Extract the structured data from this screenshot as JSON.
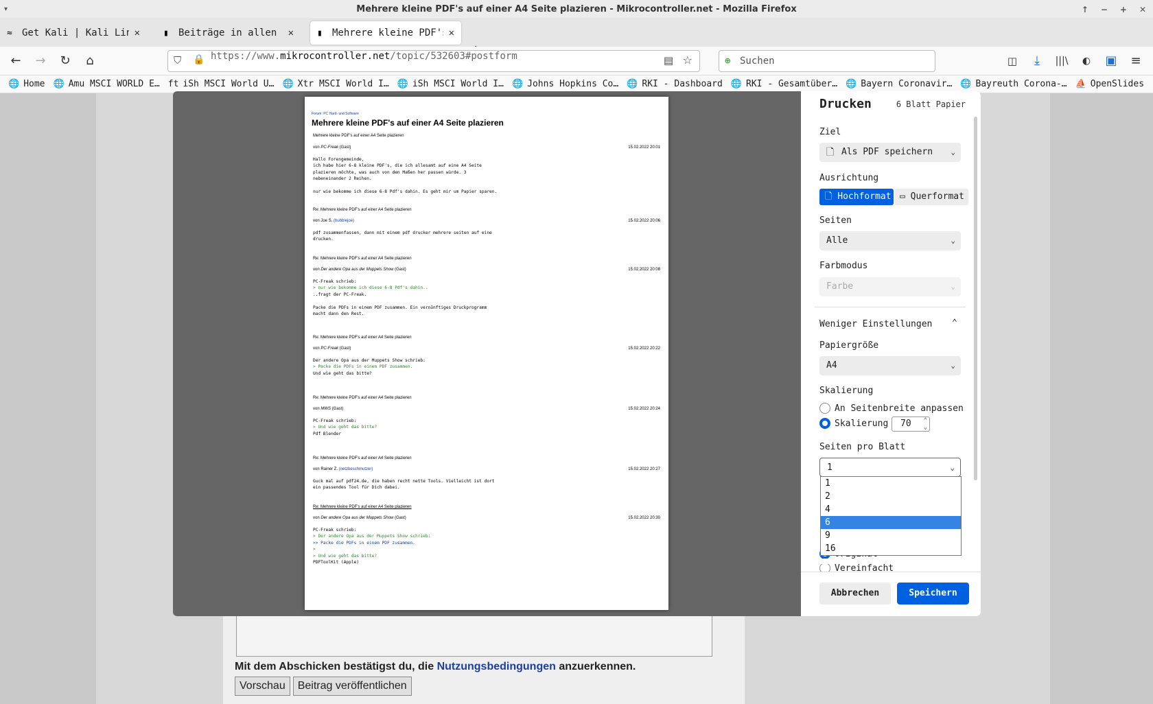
{
  "window": {
    "title": "Mehrere kleine PDF's auf einer A4 Seite plazieren - Mikrocontroller.net - Mozilla Firefox"
  },
  "tabs": [
    {
      "label": "Get Kali | Kali Linux"
    },
    {
      "label": "Beiträge in allen Foren"
    },
    {
      "label": "Mehrere kleine PDF's auf e"
    }
  ],
  "nav": {
    "url_prefix": "https://www.",
    "url_host": "mikrocontroller.net",
    "url_path": "/topic/532603#postform",
    "search_placeholder": "Suchen"
  },
  "bookmarks": [
    "Home",
    "Amu MSCI WORLD E…",
    "iSh MSCI World U…",
    "Xtr MSCI World I…",
    "iSh MSCI World I…",
    "Johns Hopkins Co…",
    "RKI - Dashboard",
    "RKI - Gesamtüber…",
    "Bayern Coronavir…",
    "Bayreuth Corona-…",
    "OpenSlides"
  ],
  "preview": {
    "forum": "Forum: PC Hard- und Software",
    "title": "Mehrere kleine PDF's auf einer A4 Seite plazieren",
    "subtitle": "Mehrere kleine PDF's auf einer A4 Seite plazieren",
    "posts": [
      {
        "header": "",
        "by": "von ",
        "author": "PC-Freak",
        "suffix": " (Gast)",
        "date": "15.02.2022 20:01",
        "body": "Hallo Forengemeinde,\nich habe hier 6-8 kleine PDF's, die ich allesamt auf eine A4 Seite\nplazieren möchte, was auch von den Maßen her passen würde. 3\nnebeneinander 2 Reihen.\n\nnur wie bekomme ich diese 6-8 Pdf's dahin. Es geht mir um Papier sparen."
      },
      {
        "header": "Re: Mehrere kleine PDF's auf einer A4 Seite plazieren",
        "by": "von ",
        "author": "Joe S.",
        "suffix": " (bubblejoe)",
        "date": "15.02.2022 20:06",
        "body": "pdf zusammenfassen, dann mit einem pdf drucker mehrere seiten auf eine\ndrucken."
      },
      {
        "header": "Re: Mehrere kleine PDF's auf einer A4 Seite plazieren",
        "by": "von ",
        "author": "Der andere Opa aus der Muppets Show",
        "suffix": " (Gast)",
        "date": "15.02.2022 20:08",
        "body_a": "PC-Freak schrieb:",
        "quote": "> nur wie bekomme ich diese 6-8 Pdf's dahin..",
        "body_b": "\n..fragt der PC-Freak.\n\nPacke die PDFs in einem PDF zusammen. Ein vernünftiges Druckprogramm\nmacht dann den Rest."
      },
      {
        "header": "Re: Mehrere kleine PDF's auf einer A4 Seite plazieren",
        "by": "von ",
        "author": "PC-Freak",
        "suffix": " (Gast)",
        "date": "15.02.2022 20:22",
        "body_a": "Der andere Opa aus der Muppets Show schrieb:",
        "quote": "> Packe die PDFs in einem PDF zusammen.",
        "body_b": "\nUnd wie geht das bitte?"
      },
      {
        "header": "Re: Mehrere kleine PDF's auf einer A4 Seite plazieren",
        "by": "von ",
        "author": "MWS",
        "suffix": " (Gast)",
        "date": "15.02.2022 20:24",
        "body_a": "PC-Freak schrieb:",
        "quote": "> Und wie geht das bitte?",
        "body_b": "\nPdf Blender"
      },
      {
        "header": "Re: Mehrere kleine PDF's auf einer A4 Seite plazieren",
        "by": "von ",
        "author": "Rainer Z.",
        "suffix": " (netzbeschmutzer)",
        "date": "15.02.2022 20:27",
        "body": "Guck mal auf pdf24.de, die haben recht nette Tools. Vielleicht ist dort\nein passendes Tool für Dich dabei."
      },
      {
        "header": "Re: Mehrere kleine PDF's auf einer A4 Seite plazieren",
        "by": "von ",
        "author": "Der andere Opa aus der Muppets Show",
        "suffix": " (Gast)",
        "date": "15.02.2022 20:30",
        "body_a": "PC-Freak schrieb:",
        "q1": "> Der andere Opa aus der Muppets Show schrieb:",
        "q2": ">> Packe die PDFs in einem PDF zusammen.",
        "q3": ">",
        "q4": "> Und wie geht das bitte?",
        "body_b": "\nPDFToolKit (Apple)"
      }
    ]
  },
  "print": {
    "title": "Drucken",
    "sheets": "6 Blatt Papier",
    "destination_label": "Ziel",
    "destination_value": "Als PDF speichern",
    "orientation_label": "Ausrichtung",
    "portrait": "Hochformat",
    "landscape": "Querformat",
    "pages_label": "Seiten",
    "pages_value": "Alle",
    "color_label": "Farbmodus",
    "color_value": "Farbe",
    "less_settings": "Weniger Einstellungen",
    "paper_label": "Papiergröße",
    "paper_value": "A4",
    "scale_label": "Skalierung",
    "fit_width": "An Seitenbreite anpassen",
    "scale": "Skalierung",
    "scale_value": "70",
    "pps_label": "Seiten pro Blatt",
    "pps_value": "1",
    "pps_options": [
      "1",
      "2",
      "4",
      "6",
      "9",
      "16"
    ],
    "pps_highlighted": "6",
    "format_original": "Original",
    "format_simplified": "Vereinfacht",
    "cancel": "Abbrechen",
    "save": "Speichern"
  },
  "page": {
    "terms_before": "Mit dem Abschicken bestätigst du, die ",
    "terms_link": "Nutzungsbedingungen",
    "terms_after": " anzuerkennen.",
    "preview_btn": "Vorschau",
    "submit_btn": "Beitrag veröffentlichen"
  },
  "colors": {
    "accent": "#0061e0",
    "highlight": "#3584e4",
    "link": "#1a3fa0",
    "quote": "#2a8a2a"
  }
}
